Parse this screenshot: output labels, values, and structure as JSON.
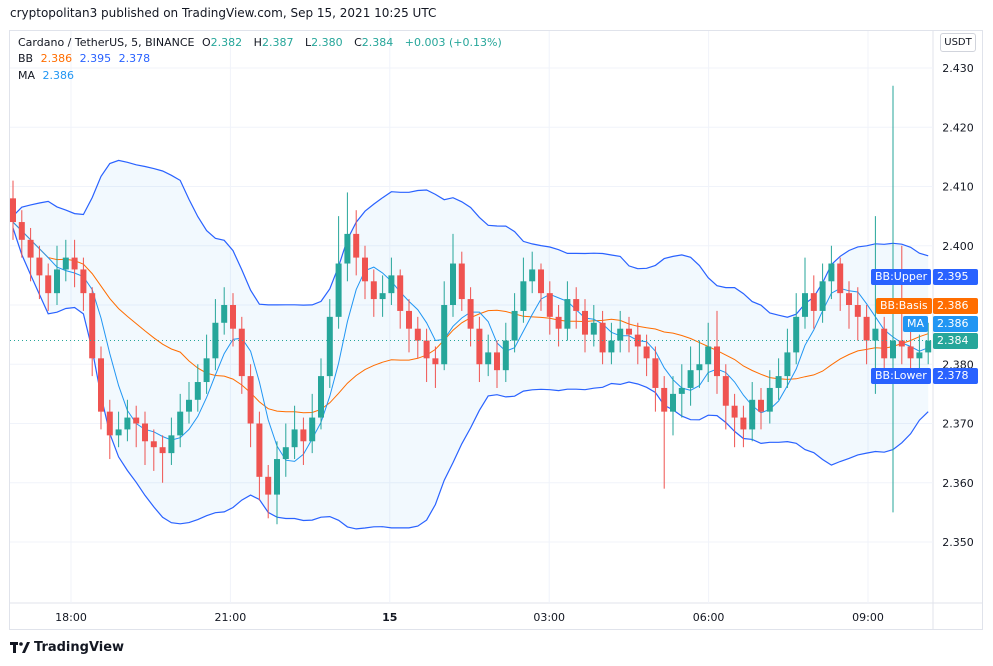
{
  "header": {
    "published": "cryptopolitan3 published on TradingView.com, Sep 15, 2021 10:25 UTC"
  },
  "legend": {
    "symbol": "Cardano / TetherUS, 5, BINANCE",
    "o_label": "O",
    "o": "2.382",
    "h_label": "H",
    "h": "2.387",
    "l_label": "L",
    "l": "2.380",
    "c_label": "C",
    "c": "2.384",
    "change": "+0.003 (+0.13%)",
    "bb_label": "BB",
    "bb_basis": "2.386",
    "bb_upper": "2.395",
    "bb_lower": "2.378",
    "ma_label": "MA",
    "ma": "2.386"
  },
  "currency_button": "USDT",
  "tags": {
    "upper_label": "BB:Upper",
    "upper_value": "2.395",
    "basis_label": "BB:Basis",
    "basis_value": "2.386",
    "ma_label": "MA",
    "ma_value": "2.386",
    "last_value": "2.384",
    "lower_label": "BB:Lower",
    "lower_value": "2.378"
  },
  "footer": {
    "brand": "TradingView"
  },
  "colors": {
    "up": "#26a69a",
    "down": "#ef5350",
    "bb_band": "#2962ff",
    "bb_basis": "#ff6d00",
    "ma": "#2196f3",
    "fill": "#2196f3"
  },
  "chart_data": {
    "type": "candlestick",
    "indicators": [
      "Bollinger Bands (basis, upper, lower)",
      "Moving Average"
    ],
    "ylim": [
      2.343,
      2.44
    ],
    "y_ticks": [
      "2.350",
      "2.360",
      "2.370",
      "2.380",
      "2.390",
      "2.400",
      "2.410",
      "2.420",
      "2.430"
    ],
    "x_ticks": [
      "18:00",
      "21:00",
      "15",
      "03:00",
      "06:00",
      "09:00"
    ],
    "grid": true,
    "last_price": 2.384,
    "ohlc": [
      [
        2.408,
        2.411,
        2.401,
        2.404
      ],
      [
        2.404,
        2.406,
        2.398,
        2.401
      ],
      [
        2.401,
        2.403,
        2.394,
        2.398
      ],
      [
        2.398,
        2.4,
        2.391,
        2.395
      ],
      [
        2.395,
        2.397,
        2.389,
        2.392
      ],
      [
        2.392,
        2.4,
        2.39,
        2.396
      ],
      [
        2.396,
        2.401,
        2.394,
        2.398
      ],
      [
        2.398,
        2.401,
        2.393,
        2.396
      ],
      [
        2.396,
        2.398,
        2.389,
        2.392
      ],
      [
        2.392,
        2.393,
        2.378,
        2.381
      ],
      [
        2.381,
        2.383,
        2.369,
        2.372
      ],
      [
        2.372,
        2.374,
        2.364,
        2.368
      ],
      [
        2.368,
        2.372,
        2.366,
        2.369
      ],
      [
        2.369,
        2.374,
        2.367,
        2.371
      ],
      [
        2.371,
        2.373,
        2.366,
        2.37
      ],
      [
        2.37,
        2.372,
        2.363,
        2.367
      ],
      [
        2.367,
        2.369,
        2.362,
        2.366
      ],
      [
        2.366,
        2.368,
        2.36,
        2.365
      ],
      [
        2.365,
        2.371,
        2.363,
        2.368
      ],
      [
        2.368,
        2.375,
        2.366,
        2.372
      ],
      [
        2.372,
        2.377,
        2.37,
        2.374
      ],
      [
        2.374,
        2.38,
        2.372,
        2.377
      ],
      [
        2.377,
        2.385,
        2.375,
        2.381
      ],
      [
        2.381,
        2.391,
        2.379,
        2.387
      ],
      [
        2.387,
        2.393,
        2.385,
        2.39
      ],
      [
        2.39,
        2.392,
        2.383,
        2.386
      ],
      [
        2.386,
        2.388,
        2.375,
        2.378
      ],
      [
        2.378,
        2.38,
        2.366,
        2.37
      ],
      [
        2.37,
        2.372,
        2.357,
        2.361
      ],
      [
        2.361,
        2.363,
        2.354,
        2.358
      ],
      [
        2.358,
        2.367,
        2.353,
        2.364
      ],
      [
        2.364,
        2.37,
        2.361,
        2.366
      ],
      [
        2.366,
        2.373,
        2.364,
        2.369
      ],
      [
        2.369,
        2.371,
        2.363,
        2.367
      ],
      [
        2.367,
        2.375,
        2.365,
        2.371
      ],
      [
        2.371,
        2.381,
        2.369,
        2.378
      ],
      [
        2.378,
        2.391,
        2.376,
        2.388
      ],
      [
        2.388,
        2.405,
        2.386,
        2.397
      ],
      [
        2.397,
        2.409,
        2.394,
        2.402
      ],
      [
        2.402,
        2.406,
        2.395,
        2.398
      ],
      [
        2.398,
        2.4,
        2.391,
        2.394
      ],
      [
        2.394,
        2.396,
        2.388,
        2.391
      ],
      [
        2.391,
        2.395,
        2.388,
        2.392
      ],
      [
        2.392,
        2.398,
        2.39,
        2.395
      ],
      [
        2.395,
        2.396,
        2.386,
        2.389
      ],
      [
        2.389,
        2.391,
        2.382,
        2.386
      ],
      [
        2.386,
        2.388,
        2.381,
        2.384
      ],
      [
        2.384,
        2.386,
        2.377,
        2.381
      ],
      [
        2.381,
        2.383,
        2.376,
        2.38
      ],
      [
        2.38,
        2.394,
        2.379,
        2.39
      ],
      [
        2.39,
        2.402,
        2.388,
        2.397
      ],
      [
        2.397,
        2.399,
        2.389,
        2.391
      ],
      [
        2.391,
        2.393,
        2.383,
        2.386
      ],
      [
        2.386,
        2.388,
        2.377,
        2.38
      ],
      [
        2.38,
        2.385,
        2.378,
        2.382
      ],
      [
        2.382,
        2.384,
        2.376,
        2.379
      ],
      [
        2.379,
        2.387,
        2.377,
        2.384
      ],
      [
        2.384,
        2.392,
        2.382,
        2.389
      ],
      [
        2.389,
        2.398,
        2.387,
        2.394
      ],
      [
        2.394,
        2.399,
        2.392,
        2.396
      ],
      [
        2.396,
        2.397,
        2.389,
        2.392
      ],
      [
        2.392,
        2.394,
        2.385,
        2.388
      ],
      [
        2.388,
        2.39,
        2.383,
        2.386
      ],
      [
        2.386,
        2.394,
        2.384,
        2.391
      ],
      [
        2.391,
        2.393,
        2.386,
        2.389
      ],
      [
        2.389,
        2.391,
        2.382,
        2.385
      ],
      [
        2.385,
        2.39,
        2.383,
        2.387
      ],
      [
        2.387,
        2.389,
        2.38,
        2.382
      ],
      [
        2.382,
        2.387,
        2.38,
        2.384
      ],
      [
        2.384,
        2.389,
        2.382,
        2.386
      ],
      [
        2.386,
        2.388,
        2.382,
        2.385
      ],
      [
        2.385,
        2.387,
        2.38,
        2.383
      ],
      [
        2.383,
        2.385,
        2.378,
        2.381
      ],
      [
        2.381,
        2.383,
        2.372,
        2.376
      ],
      [
        2.376,
        2.378,
        2.359,
        2.372
      ],
      [
        2.372,
        2.378,
        2.368,
        2.375
      ],
      [
        2.375,
        2.38,
        2.371,
        2.376
      ],
      [
        2.376,
        2.383,
        2.373,
        2.379
      ],
      [
        2.379,
        2.384,
        2.376,
        2.38
      ],
      [
        2.38,
        2.387,
        2.377,
        2.383
      ],
      [
        2.383,
        2.389,
        2.375,
        2.378
      ],
      [
        2.378,
        2.38,
        2.369,
        2.373
      ],
      [
        2.373,
        2.375,
        2.366,
        2.371
      ],
      [
        2.371,
        2.373,
        2.366,
        2.369
      ],
      [
        2.369,
        2.377,
        2.367,
        2.374
      ],
      [
        2.374,
        2.376,
        2.369,
        2.372
      ],
      [
        2.372,
        2.379,
        2.37,
        2.376
      ],
      [
        2.376,
        2.381,
        2.374,
        2.378
      ],
      [
        2.378,
        2.386,
        2.376,
        2.382
      ],
      [
        2.382,
        2.392,
        2.38,
        2.388
      ],
      [
        2.388,
        2.398,
        2.386,
        2.392
      ],
      [
        2.392,
        2.395,
        2.386,
        2.389
      ],
      [
        2.389,
        2.397,
        2.387,
        2.394
      ],
      [
        2.394,
        2.4,
        2.391,
        2.397
      ],
      [
        2.397,
        2.398,
        2.389,
        2.392
      ],
      [
        2.392,
        2.394,
        2.386,
        2.39
      ],
      [
        2.39,
        2.393,
        2.384,
        2.388
      ],
      [
        2.388,
        2.39,
        2.38,
        2.384
      ],
      [
        2.384,
        2.405,
        2.375,
        2.386
      ],
      [
        2.386,
        2.388,
        2.377,
        2.381
      ],
      [
        2.381,
        2.427,
        2.355,
        2.384
      ],
      [
        2.384,
        2.4,
        2.38,
        2.383
      ],
      [
        2.383,
        2.386,
        2.379,
        2.381
      ],
      [
        2.381,
        2.385,
        2.379,
        2.382
      ],
      [
        2.382,
        2.387,
        2.38,
        2.384
      ]
    ]
  }
}
